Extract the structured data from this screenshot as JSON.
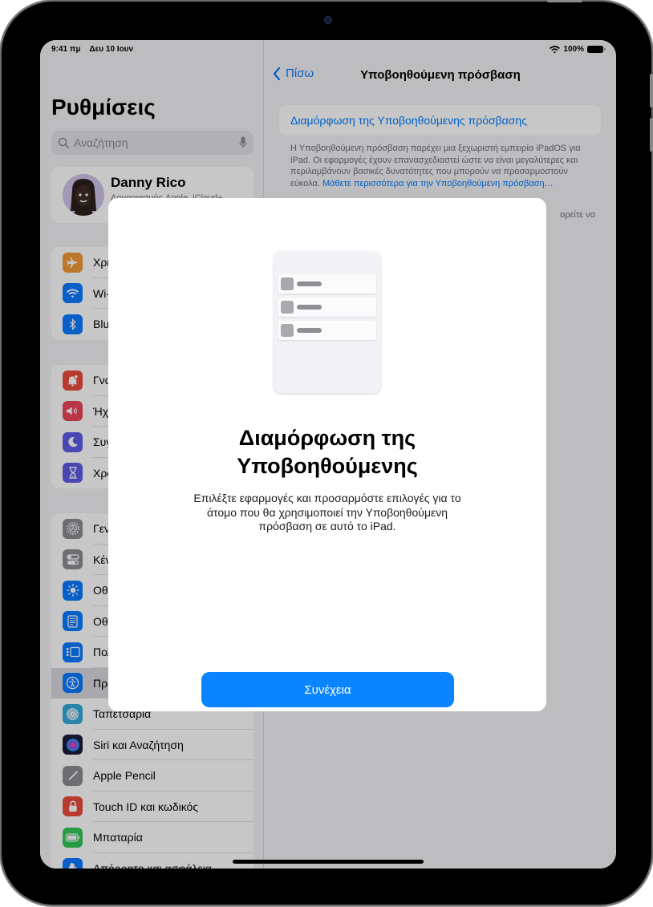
{
  "status_bar": {
    "time": "9:41 πμ",
    "date": "Δευ 10 Ιουν",
    "battery": "100%"
  },
  "sidebar": {
    "title": "Ρυθμίσεις",
    "search_placeholder": "Αναζήτηση",
    "profile": {
      "name": "Danny Rico",
      "subtitle": "Λογαριασμός Apple, iCloud+"
    },
    "groups": [
      {
        "items": [
          {
            "label": "Χρήση σε αεροπλάνο",
            "icon": "airplane-icon",
            "color": "#f09a37"
          },
          {
            "label": "Wi-Fi",
            "icon": "wifi-icon",
            "color": "#0a7aff"
          },
          {
            "label": "Bluetooth",
            "icon": "bluetooth-icon",
            "color": "#0a7aff"
          }
        ]
      },
      {
        "items": [
          {
            "label": "Γνωστοποιήσεις",
            "icon": "notifications-icon",
            "color": "#eb4d3d"
          },
          {
            "label": "Ήχοι",
            "icon": "sound-icon",
            "color": "#eb445a"
          },
          {
            "label": "Συγκέντρωση",
            "icon": "moon-icon",
            "color": "#5e5ce6"
          },
          {
            "label": "Χρόνος επί οθόνης",
            "icon": "hourglass-icon",
            "color": "#5e5ce6"
          }
        ]
      },
      {
        "items": [
          {
            "label": "Γενικά",
            "icon": "gear-icon",
            "color": "#8e8e93"
          },
          {
            "label": "Κέντρο ελέγχου",
            "icon": "control-center-icon",
            "color": "#8e8e93"
          },
          {
            "label": "Οθόνη και φωτεινότητα",
            "icon": "brightness-icon",
            "color": "#0a7aff"
          },
          {
            "label": "Οθόνη Αφετηρίας",
            "icon": "home-screen-icon",
            "color": "#0a7aff"
          },
          {
            "label": "Πολυδιεργασία",
            "icon": "multitasking-icon",
            "color": "#0a7aff"
          },
          {
            "label": "Προσβασιμότητα",
            "icon": "accessibility-icon",
            "color": "#0a7aff",
            "selected": true
          },
          {
            "label": "Ταπετσαρία",
            "icon": "wallpaper-icon",
            "color": "#35aadc"
          },
          {
            "label": "Siri και Αναζήτηση",
            "icon": "siri-icon",
            "color": "#1c1c3a"
          },
          {
            "label": "Apple Pencil",
            "icon": "pencil-icon",
            "color": "#8e8e93"
          },
          {
            "label": "Touch ID και κωδικός",
            "icon": "lock-icon",
            "color": "#eb4d3d"
          },
          {
            "label": "Μπαταρία",
            "icon": "battery-icon",
            "color": "#34c759"
          },
          {
            "label": "Απόρρητο και ασφάλεια",
            "icon": "privacy-hand-icon",
            "color": "#0a7aff"
          }
        ]
      }
    ]
  },
  "detail": {
    "back_label": "Πίσω",
    "title": "Υποβοηθούμενη πρόσβαση",
    "setup_cell": "Διαμόρφωση της Υποβοηθούμενης πρόσβασης",
    "footer": "Η Υποβοηθούμενη πρόσβαση παρέχει μια ξεχωριστή εμπειρία iPadOS για iPad. Οι εφαρμογές έχουν επανασχεδιαστεί ώστε να είναι μεγαλύτερες και περιλαμβάνουν βασικές δυνατότητες που μπορούν να προσαρμοστούν εύκολα. ",
    "footer_link": "Μάθετε περισσότερα για την Υποβοηθούμενη πρόσβαση…",
    "footer_partial": "ορείτε να"
  },
  "modal": {
    "title_line1": "Διαμόρφωση της",
    "title_line2": "Υποβοηθούμενης",
    "body": "Επιλέξτε εφαρμογές και προσαρμόστε επιλογές για το άτομο που θα χρησιμοποιεί την Υποβοηθούμενη πρόσβαση σε αυτό το iPad.",
    "continue_label": "Συνέχεια"
  },
  "colors": {
    "accent": "#0a84ff",
    "link": "#007aff"
  }
}
